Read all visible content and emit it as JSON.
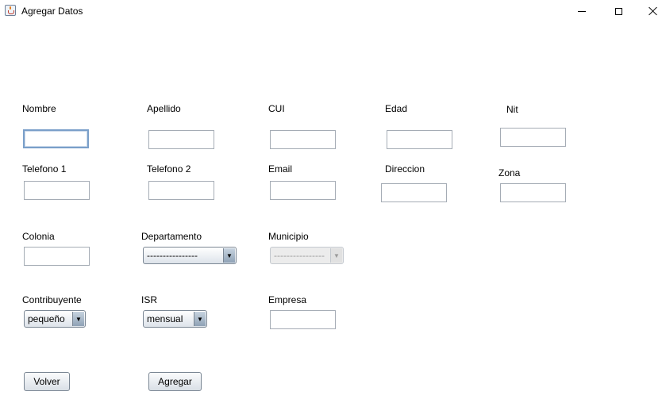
{
  "window": {
    "title": "Agregar Datos",
    "icon": "java-cup-icon"
  },
  "form": {
    "labels": {
      "nombre": "Nombre",
      "apellido": "Apellido",
      "cui": "CUI",
      "edad": "Edad",
      "nit": "Nit",
      "telefono1": "Telefono 1",
      "telefono2": "Telefono 2",
      "email": "Email",
      "direccion": "Direccion",
      "zona": "Zona",
      "colonia": "Colonia",
      "departamento": "Departamento",
      "municipio": "Municipio",
      "contribuyente": "Contribuyente",
      "isr": "ISR",
      "empresa": "Empresa"
    },
    "values": {
      "nombre": "",
      "apellido": "",
      "cui": "",
      "edad": "",
      "nit": "",
      "telefono1": "",
      "telefono2": "",
      "email": "",
      "direccion": "",
      "zona": "",
      "colonia": "",
      "empresa": ""
    },
    "selects": {
      "departamento": "----------------",
      "municipio": "----------------",
      "contribuyente": "pequeño",
      "isr": "mensual"
    }
  },
  "buttons": {
    "volver": "Volver",
    "agregar": "Agregar"
  }
}
